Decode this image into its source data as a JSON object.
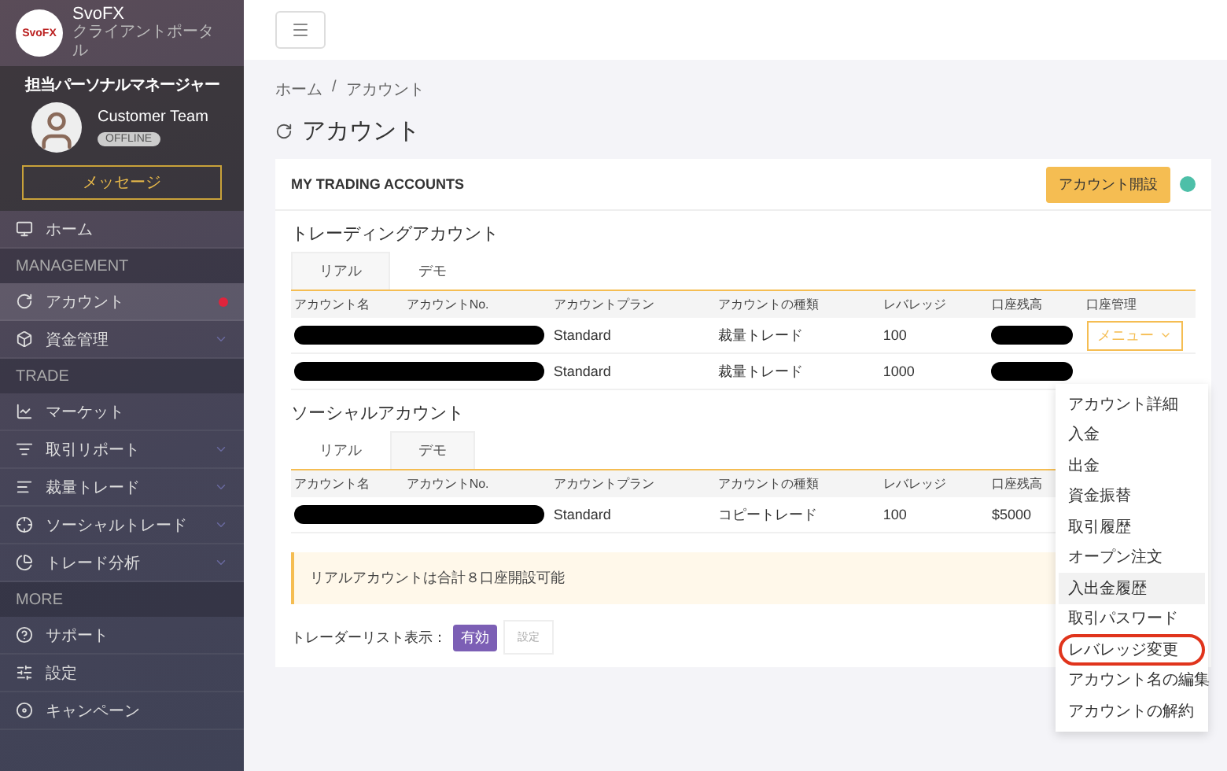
{
  "brand": {
    "logo": "SvoFX",
    "name": "SvoFX",
    "subtitle": "クライアントポータル"
  },
  "manager": {
    "title": "担当パーソナルマネージャー",
    "name": "Customer Team",
    "status": "OFFLINE",
    "online": false,
    "button": "メッセージ"
  },
  "sidebar": {
    "items": [
      {
        "kind": "item",
        "label": "ホーム",
        "selected": false,
        "badge": false,
        "expandable": false
      },
      {
        "kind": "section",
        "label": "MANAGEMENT"
      },
      {
        "kind": "item",
        "label": "アカウント",
        "selected": true,
        "badge": true,
        "expandable": false
      },
      {
        "kind": "item",
        "label": "資金管理",
        "selected": false,
        "badge": false,
        "expandable": true
      },
      {
        "kind": "section",
        "label": "TRADE"
      },
      {
        "kind": "item",
        "label": "マーケット",
        "selected": false,
        "badge": false,
        "expandable": false
      },
      {
        "kind": "item",
        "label": "取引リポート",
        "selected": false,
        "badge": false,
        "expandable": true
      },
      {
        "kind": "item",
        "label": "裁量トレード",
        "selected": false,
        "badge": false,
        "expandable": true
      },
      {
        "kind": "item",
        "label": "ソーシャルトレード",
        "selected": false,
        "badge": false,
        "expandable": true
      },
      {
        "kind": "item",
        "label": "トレード分析",
        "selected": false,
        "badge": false,
        "expandable": true
      },
      {
        "kind": "section",
        "label": "MORE"
      },
      {
        "kind": "item",
        "label": "サポート",
        "selected": false,
        "badge": false,
        "expandable": false
      },
      {
        "kind": "item",
        "label": "設定",
        "selected": false,
        "badge": false,
        "expandable": false
      },
      {
        "kind": "item",
        "label": "キャンペーン",
        "selected": false,
        "badge": false,
        "expandable": false
      }
    ]
  },
  "breadcrumb": {
    "items": [
      "ホーム",
      "アカウント"
    ],
    "separator": "/"
  },
  "page_title": "アカウント",
  "card": {
    "title": "MY TRADING ACCOUNTS",
    "button": "アカウント開設",
    "status_dot": {
      "color": "#4dbfa8"
    },
    "sections": [
      {
        "title": "トレーディングアカウント",
        "tabs": [
          {
            "label": "リアル",
            "selected": true
          },
          {
            "label": "デモ",
            "selected": false
          }
        ],
        "columns": [
          "アカウント名",
          "アカウントNo.",
          "アカウントプラン",
          "アカウントの種類",
          "レバレッジ",
          "口座残高",
          "口座管理"
        ],
        "rows": [
          [
            {
              "kind": "redacted_left"
            },
            {
              "kind": "redacted_right"
            },
            {
              "kind": "text",
              "text": "Standard"
            },
            {
              "kind": "text",
              "text": "裁量トレード"
            },
            {
              "kind": "text",
              "text": "100"
            },
            {
              "kind": "redacted"
            },
            {
              "kind": "menu",
              "text": "メニュー"
            }
          ],
          [
            {
              "kind": "redacted_left"
            },
            {
              "kind": "redacted_right"
            },
            {
              "kind": "text",
              "text": "Standard"
            },
            {
              "kind": "text",
              "text": "裁量トレード"
            },
            {
              "kind": "text",
              "text": "1000"
            },
            {
              "kind": "redacted"
            },
            {
              "kind": "empty"
            }
          ]
        ]
      },
      {
        "title": "ソーシャルアカウント",
        "tabs": [
          {
            "label": "リアル",
            "selected": false
          },
          {
            "label": "デモ",
            "selected": true
          }
        ],
        "columns": [
          "アカウント名",
          "アカウントNo.",
          "アカウントプラン",
          "アカウントの種類",
          "レバレッジ",
          "口座残高",
          ""
        ],
        "rows": [
          [
            {
              "kind": "redacted_left"
            },
            {
              "kind": "redacted_right"
            },
            {
              "kind": "text",
              "text": "Standard"
            },
            {
              "kind": "text",
              "text": "コピートレード"
            },
            {
              "kind": "text",
              "text": "100"
            },
            {
              "kind": "text",
              "text": "$5000"
            },
            {
              "kind": "empty"
            }
          ]
        ]
      }
    ],
    "notice": "リアルアカウントは合計８口座開設可能",
    "trader_list": {
      "label": "トレーダーリスト表示：",
      "status": "有効",
      "enabled": true,
      "button": "設定"
    }
  },
  "dropdown": {
    "items": [
      {
        "label": "アカウント詳細",
        "selected": false,
        "circled": false
      },
      {
        "label": "入金",
        "selected": false,
        "circled": false
      },
      {
        "label": "出金",
        "selected": false,
        "circled": false
      },
      {
        "label": "資金振替",
        "selected": false,
        "circled": false
      },
      {
        "label": "取引履歴",
        "selected": false,
        "circled": false
      },
      {
        "label": "オープン注文",
        "selected": false,
        "circled": false
      },
      {
        "label": "入出金履歴",
        "selected": true,
        "circled": false
      },
      {
        "label": "取引パスワード",
        "selected": false,
        "circled": false
      },
      {
        "label": "レバレッジ変更",
        "selected": false,
        "circled": true
      },
      {
        "label": "アカウント名の編集",
        "selected": false,
        "circled": false
      },
      {
        "label": "アカウントの解約",
        "selected": false,
        "circled": false
      }
    ]
  }
}
